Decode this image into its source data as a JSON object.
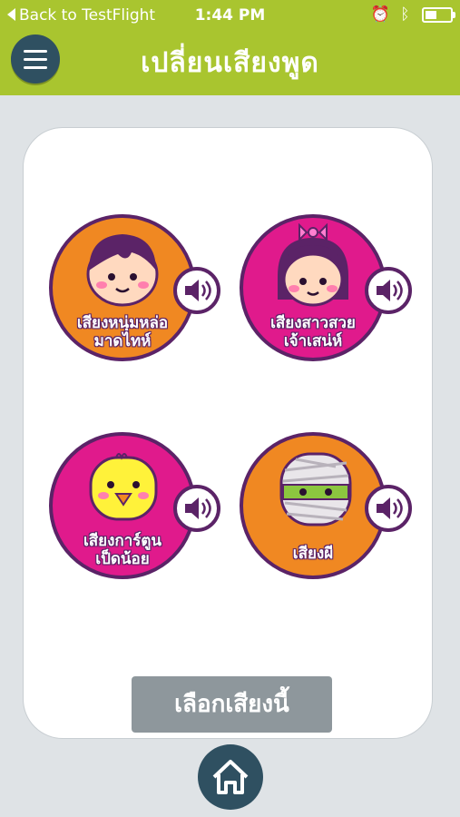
{
  "status_bar": {
    "back_label": "Back to TestFlight",
    "time": "1:44 PM"
  },
  "header": {
    "title": "เปลี่ยนเสียงพูด",
    "menu_icon": "hamburger-menu-icon"
  },
  "voices": [
    {
      "label_line1": "เสียงหนุ่มหล่อ",
      "label_line2": "มาดไทห์",
      "color": "#f08822"
    },
    {
      "label_line1": "เสียงสาวสวย",
      "label_line2": "เจ้าเสน่ห์",
      "color": "#e01a8c"
    },
    {
      "label_line1": "เสียงการ์ตูน",
      "label_line2": "เป็ดน้อย",
      "color": "#e01a8c"
    },
    {
      "label_line1": "เสียงผี",
      "label_line2": "",
      "color": "#f08822"
    }
  ],
  "select_button": {
    "label": "เลือกเสียงนี้"
  },
  "home_icon": "home-icon",
  "colors": {
    "header": "#a9c52f",
    "dark_button": "#2f5061",
    "outline": "#5b2367"
  }
}
